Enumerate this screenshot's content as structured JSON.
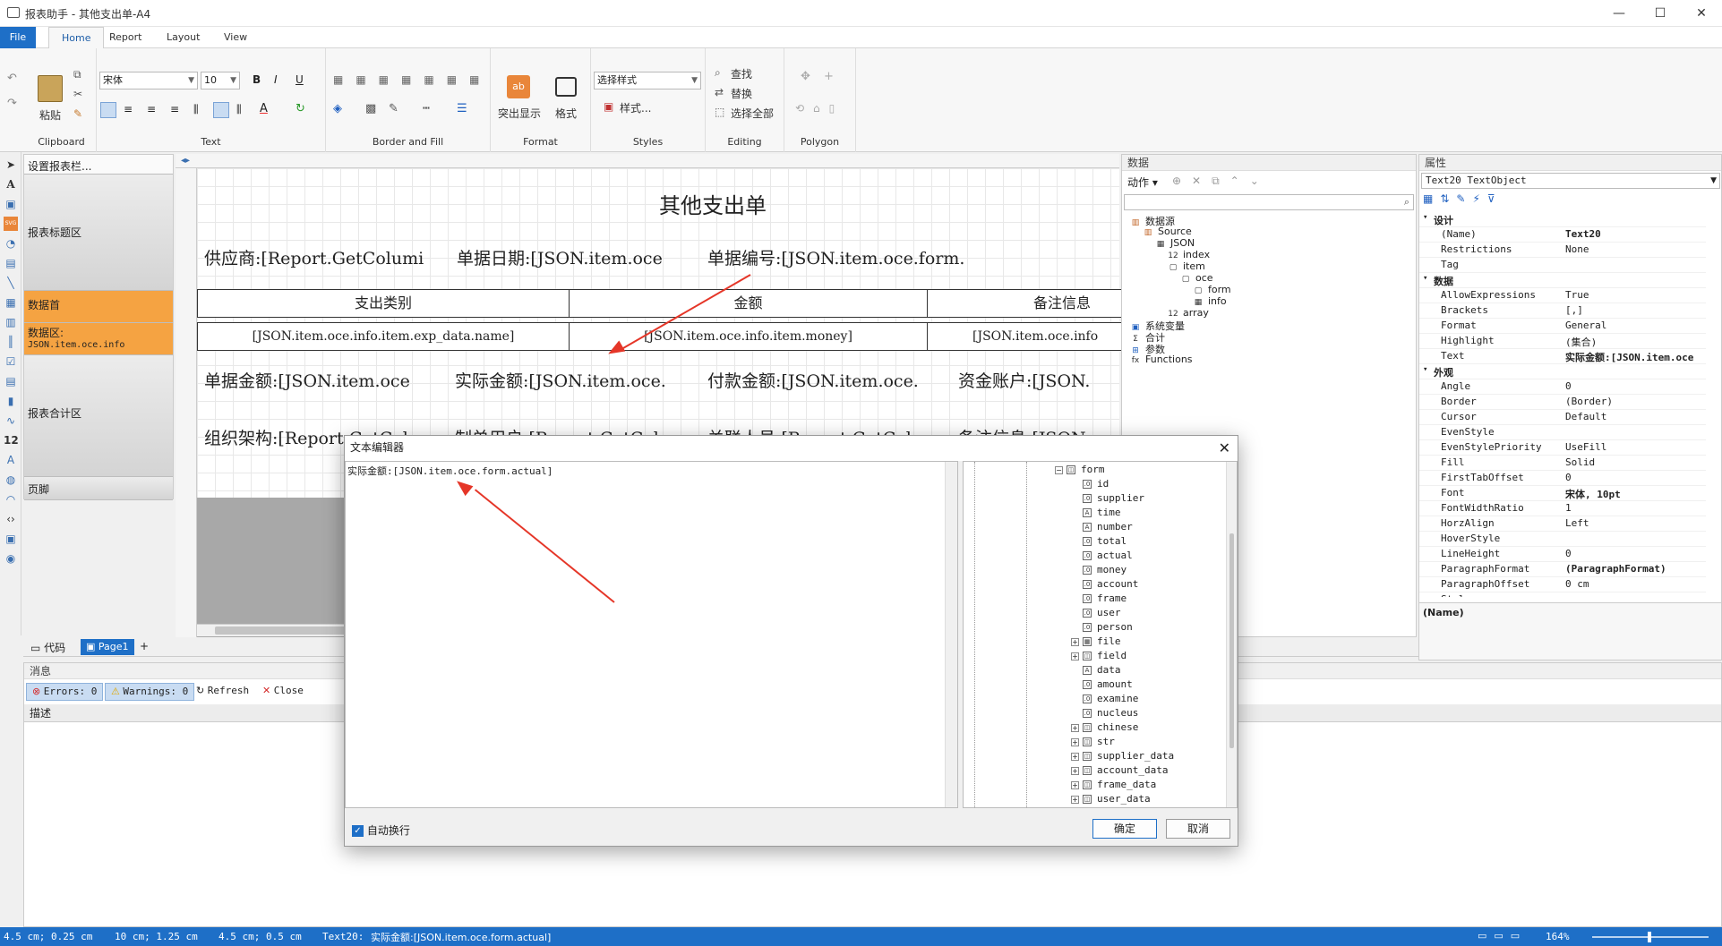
{
  "window": {
    "title": "报表助手 - 其他支出单-A4",
    "minimize": "—",
    "maximize": "☐",
    "close": "✕"
  },
  "ribbon_tabs": [
    "File",
    "Home",
    "Report",
    "Layout",
    "View"
  ],
  "ribbon": {
    "clipboard": {
      "label": "Clipboard",
      "paste": "粘贴"
    },
    "text": {
      "label": "Text",
      "font": "宋体",
      "size": "10"
    },
    "border_fill": {
      "label": "Border and Fill"
    },
    "format": {
      "label": "Format",
      "highlight": "突出显示",
      "format": "格式"
    },
    "styles": {
      "label": "Styles",
      "select_style": "选择样式",
      "style_btn": "样式..."
    },
    "editing": {
      "label": "Editing",
      "find": "查找",
      "replace": "替换",
      "select_all": "选择全部"
    },
    "polygon": {
      "label": "Polygon"
    }
  },
  "bands": {
    "settings": "设置报表栏...",
    "title_area": "报表标题区",
    "data_header": "数据首",
    "data_area_label": "数据区:",
    "data_area_source": "JSON.item.oce.info",
    "summary_area": "报表合计区",
    "footer": "页脚"
  },
  "report": {
    "title": "其他支出单",
    "row1": [
      "供应商:[Report.GetColumi",
      "单据日期:[JSON.item.oce",
      "单据编号:[JSON.item.oce.form."
    ],
    "table_headers": [
      "支出类别",
      "金额",
      "备注信息"
    ],
    "table_cells": [
      "[JSON.item.oce.info.item.exp_data.name]",
      "[JSON.item.oce.info.item.money]",
      "[JSON.item.oce.info"
    ],
    "row3": [
      "单据金额:[JSON.item.oce",
      "实际金额:[JSON.item.oce.",
      "付款金额:[JSON.item.oce.",
      "资金账户:[JSON."
    ],
    "row4": [
      "组织架构:[Report.GetCol",
      "制单用户:[Report.GetCol",
      "关联人员:[Report.GetCol",
      "备注信息:[JSON."
    ]
  },
  "data_panel": {
    "title": "数据",
    "action": "动作",
    "tree": [
      {
        "label": "数据源",
        "indent": 0,
        "icon": "db"
      },
      {
        "label": "Source",
        "indent": 1,
        "icon": "db"
      },
      {
        "label": "JSON",
        "indent": 2,
        "icon": "table"
      },
      {
        "label": "index",
        "indent": 3,
        "icon": "num"
      },
      {
        "label": "item",
        "indent": 3,
        "icon": "obj"
      },
      {
        "label": "oce",
        "indent": 4,
        "icon": "obj"
      },
      {
        "label": "form",
        "indent": 5,
        "icon": "obj"
      },
      {
        "label": "info",
        "indent": 5,
        "icon": "table"
      },
      {
        "label": "array",
        "indent": 3,
        "icon": "num"
      },
      {
        "label": "系统变量",
        "indent": 0,
        "icon": "var"
      },
      {
        "label": "合计",
        "indent": 0,
        "icon": "sum"
      },
      {
        "label": "参数",
        "indent": 0,
        "icon": "param"
      },
      {
        "label": "Functions",
        "indent": 0,
        "icon": "fx"
      }
    ]
  },
  "props_panel": {
    "title": "属性",
    "object": "Text20 TextObject",
    "rows": [
      {
        "cat": true,
        "name": "设计"
      },
      {
        "name": "(Name)",
        "value": "Text20",
        "bold": true
      },
      {
        "name": "Restrictions",
        "value": "None"
      },
      {
        "name": "Tag",
        "value": ""
      },
      {
        "cat": true,
        "name": "数据"
      },
      {
        "name": "AllowExpressions",
        "value": "True"
      },
      {
        "name": "Brackets",
        "value": "[,]"
      },
      {
        "name": "Format",
        "value": "General"
      },
      {
        "name": "Highlight",
        "value": "(集合)"
      },
      {
        "name": "Text",
        "value": "实际金额:[JSON.item.oce",
        "bold": true
      },
      {
        "cat": true,
        "name": "外观"
      },
      {
        "name": "Angle",
        "value": "0"
      },
      {
        "name": "Border",
        "value": "(Border)"
      },
      {
        "name": "Cursor",
        "value": "Default"
      },
      {
        "name": "EvenStyle",
        "value": ""
      },
      {
        "name": "EvenStylePriority",
        "value": "UseFill"
      },
      {
        "name": "Fill",
        "value": "Solid"
      },
      {
        "name": "FirstTabOffset",
        "value": "0"
      },
      {
        "name": "Font",
        "value": "宋体, 10pt",
        "bold": true
      },
      {
        "name": "FontWidthRatio",
        "value": "1"
      },
      {
        "name": "HorzAlign",
        "value": "Left"
      },
      {
        "name": "HoverStyle",
        "value": ""
      },
      {
        "name": "LineHeight",
        "value": "0"
      },
      {
        "name": "ParagraphFormat",
        "value": "(ParagraphFormat)",
        "bold": true
      },
      {
        "name": "ParagraphOffset",
        "value": "0 cm"
      },
      {
        "name": "Style",
        "value": ""
      }
    ],
    "desc": "(Name)"
  },
  "page_tabs": {
    "code": "代码",
    "page1": "Page1",
    "add": "+"
  },
  "messages": {
    "title": "消息",
    "errors": "Errors: 0",
    "warnings": "Warnings: 0",
    "refresh": "Refresh",
    "close": "Close",
    "col_desc": "描述"
  },
  "dialog": {
    "title": "文本编辑器",
    "content": "实际金额:[JSON.item.oce.form.actual]",
    "wrap_label": "自动换行",
    "ok": "确定",
    "cancel": "取消",
    "fields": [
      {
        "label": "form",
        "kind": "obj",
        "indent": 0,
        "expand": true
      },
      {
        "label": "id",
        "kind": "num",
        "indent": 1
      },
      {
        "label": "supplier",
        "kind": "num",
        "indent": 1
      },
      {
        "label": "time",
        "kind": "text",
        "indent": 1
      },
      {
        "label": "number",
        "kind": "text",
        "indent": 1
      },
      {
        "label": "total",
        "kind": "num",
        "indent": 1
      },
      {
        "label": "actual",
        "kind": "num",
        "indent": 1
      },
      {
        "label": "money",
        "kind": "num",
        "indent": 1
      },
      {
        "label": "account",
        "kind": "num",
        "indent": 1
      },
      {
        "label": "frame",
        "kind": "num",
        "indent": 1
      },
      {
        "label": "user",
        "kind": "num",
        "indent": 1
      },
      {
        "label": "person",
        "kind": "num",
        "indent": 1
      },
      {
        "label": "file",
        "kind": "table",
        "indent": 1,
        "expand": true
      },
      {
        "label": "field",
        "kind": "obj",
        "indent": 1,
        "expand": true
      },
      {
        "label": "data",
        "kind": "text",
        "indent": 1
      },
      {
        "label": "amount",
        "kind": "num",
        "indent": 1
      },
      {
        "label": "examine",
        "kind": "num",
        "indent": 1
      },
      {
        "label": "nucleus",
        "kind": "num",
        "indent": 1
      },
      {
        "label": "chinese",
        "kind": "obj",
        "indent": 1,
        "expand": true
      },
      {
        "label": "str",
        "kind": "obj",
        "indent": 1,
        "expand": true
      },
      {
        "label": "supplier_data",
        "kind": "obj",
        "indent": 1,
        "expand": true
      },
      {
        "label": "account_data",
        "kind": "obj",
        "indent": 1,
        "expand": true
      },
      {
        "label": "frame_data",
        "kind": "obj",
        "indent": 1,
        "expand": true
      },
      {
        "label": "user_data",
        "kind": "obj",
        "indent": 1,
        "expand": true
      }
    ]
  },
  "status": {
    "pos": "4.5 cm; 0.25 cm",
    "size": "10 cm; 1.25 cm",
    "pos2": "4.5 cm; 0.5 cm",
    "object": "Text20:",
    "text": "实际金额:[JSON.item.oce.form.actual]",
    "zoom": "164%"
  },
  "colors": {
    "accent": "#1e6fc7",
    "band_orange": "#f5a342",
    "arrow": "#e53628"
  }
}
